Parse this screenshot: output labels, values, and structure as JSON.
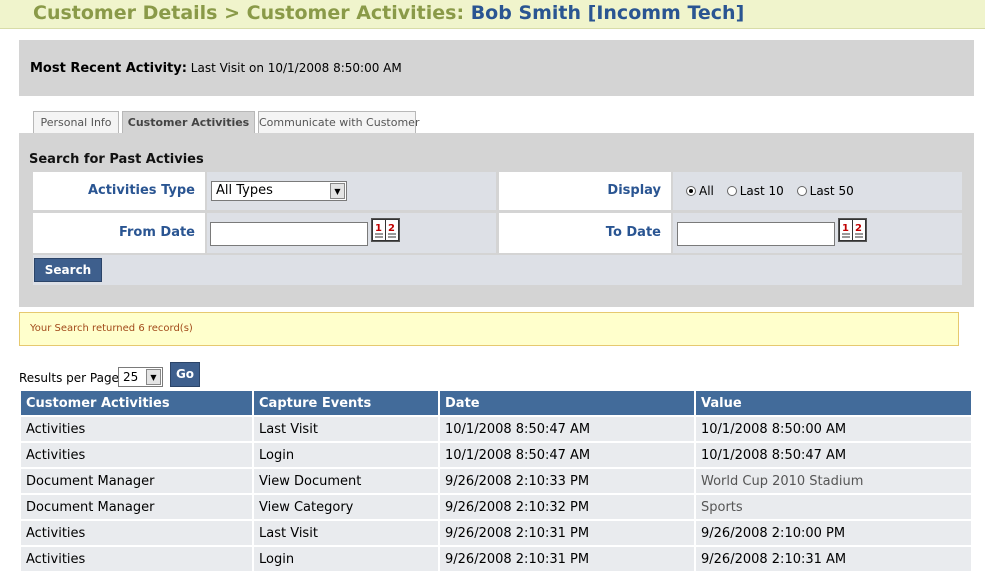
{
  "header": {
    "breadcrumb": "Customer Details > Customer Activities: ",
    "customer": "Bob Smith [Incomm Tech]"
  },
  "recent": {
    "label": "Most Recent Activity:",
    "value": "Last Visit on 10/1/2008 8:50:00 AM"
  },
  "tabs": [
    {
      "label": "Personal Info"
    },
    {
      "label": "Customer Activities"
    },
    {
      "label": "Communicate with Customer"
    }
  ],
  "search": {
    "title": "Search for Past Activies",
    "activities_type_label": "Activities Type",
    "activities_type_value": "All Types",
    "display_label": "Display",
    "display_options": [
      "All",
      "Last 10",
      "Last 50"
    ],
    "display_selected": "All",
    "from_date_label": "From Date",
    "from_date_value": "",
    "to_date_label": "To Date",
    "to_date_value": "",
    "search_button": "Search"
  },
  "notice": "Your Search returned 6 record(s)",
  "pagination": {
    "results_label": "Results per Page:",
    "results_value": "25",
    "go_button": "Go"
  },
  "table": {
    "columns": [
      "Customer Activities",
      "Capture Events",
      "Date",
      "Value"
    ],
    "rows": [
      [
        "Activities",
        "Last Visit",
        "10/1/2008 8:50:47 AM",
        "10/1/2008 8:50:00 AM"
      ],
      [
        "Activities",
        "Login",
        "10/1/2008 8:50:47 AM",
        "10/1/2008 8:50:47 AM"
      ],
      [
        "Document Manager",
        "View Document",
        "9/26/2008 2:10:33 PM",
        "World Cup 2010 Stadium"
      ],
      [
        "Document Manager",
        "View Category",
        "9/26/2008 2:10:32 PM",
        "Sports"
      ],
      [
        "Activities",
        "Last Visit",
        "9/26/2008 2:10:31 PM",
        "9/26/2008 2:10:00 PM"
      ],
      [
        "Activities",
        "Login",
        "9/26/2008 2:10:31 PM",
        "9/26/2008 2:10:31 AM"
      ]
    ]
  }
}
